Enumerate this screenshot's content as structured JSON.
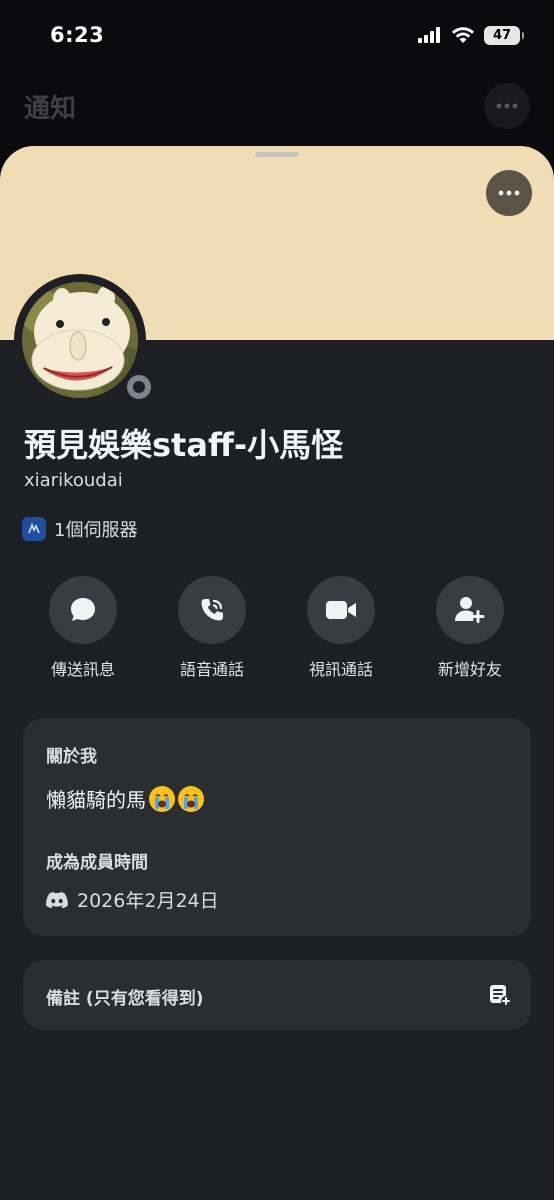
{
  "status_bar": {
    "time": "6:23",
    "battery": "47"
  },
  "background_header": {
    "title": "通知"
  },
  "profile": {
    "display_name": "預見娛樂staff-小馬怪",
    "username": "xiarikoudai",
    "servers_text": "1個伺服器"
  },
  "actions": [
    {
      "label": "傳送訊息",
      "icon": "chat-bubble-icon"
    },
    {
      "label": "語音通話",
      "icon": "phone-call-icon"
    },
    {
      "label": "視訊通話",
      "icon": "video-camera-icon"
    },
    {
      "label": "新增好友",
      "icon": "add-friend-icon"
    }
  ],
  "about": {
    "heading": "關於我",
    "text": "懶貓騎的馬",
    "emojis": [
      "loudly-crying-face",
      "loudly-crying-face"
    ]
  },
  "member_since": {
    "heading": "成為成員時間",
    "date": "2026年2月24日"
  },
  "note": {
    "label": "備註 (只有您看得到)"
  },
  "colors": {
    "banner": "#f1ddb5",
    "sheet": "#1e1f24",
    "card": "#2b2d31",
    "action_circle": "#3a3c43"
  }
}
